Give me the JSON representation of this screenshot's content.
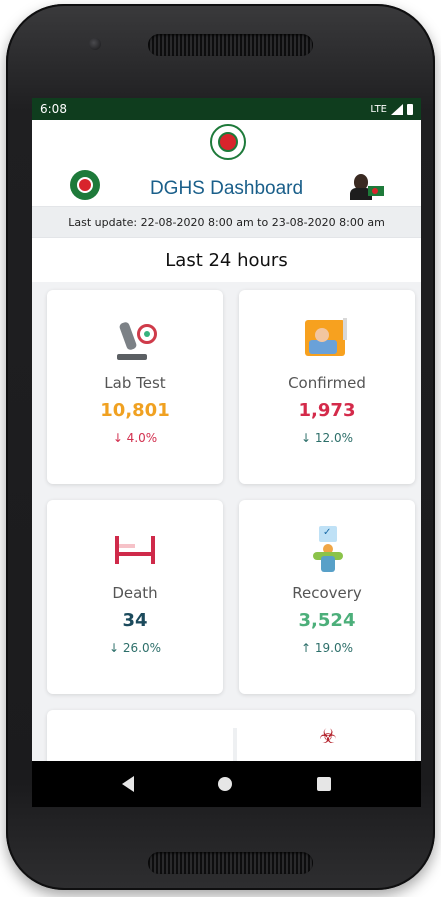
{
  "status": {
    "time": "6:08",
    "network": "LTE"
  },
  "header": {
    "title": "DGHS Dashboard"
  },
  "update": {
    "text": "Last update: 22-08-2020 8:00 am to 23-08-2020 8:00 am"
  },
  "section": {
    "title": "Last 24 hours"
  },
  "cards": [
    {
      "label": "Lab Test",
      "value": "10,801",
      "change": "↓ 4.0%",
      "value_color": "#f0a121",
      "change_color": "#d2304f",
      "icon": "microscope-icon"
    },
    {
      "label": "Confirmed",
      "value": "1,973",
      "change": "↓ 12.0%",
      "value_color": "#d42a4a",
      "change_color": "#2d6f6a",
      "icon": "patient-bed-icon"
    },
    {
      "label": "Death",
      "value": "34",
      "change": "↓ 26.0%",
      "value_color": "#1b4a5c",
      "change_color": "#2d6f6a",
      "icon": "coffin-icon"
    },
    {
      "label": "Recovery",
      "value": "3,524",
      "change": "↑ 19.0%",
      "value_color": "#4caf7a",
      "change_color": "#2d6f6a",
      "icon": "recovery-person-icon"
    }
  ],
  "colors": {
    "status_bar": "#0f3d1e",
    "title": "#1a5f8a"
  }
}
